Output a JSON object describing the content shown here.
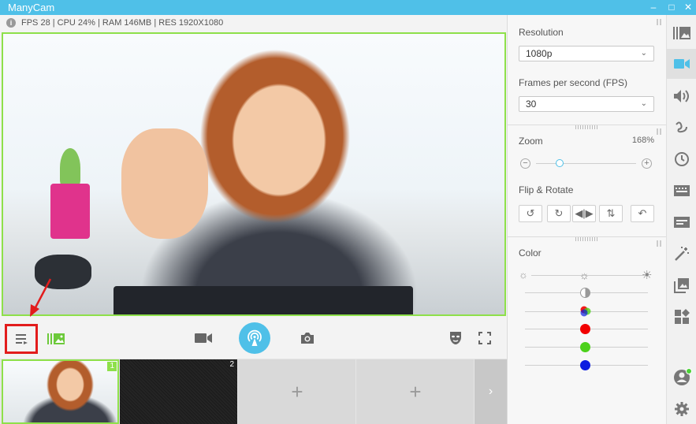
{
  "app": {
    "title": "ManyCam",
    "window_controls": {
      "minimize": "–",
      "maximize": "□",
      "close": "✕"
    }
  },
  "status_bar": {
    "info_icon": "i",
    "text": "FPS 28 | CPU 24% | RAM 146MB | RES 1920X1080"
  },
  "thumbnails": [
    {
      "number": "1",
      "type": "webcam",
      "active": true
    },
    {
      "number": "2",
      "type": "noise",
      "active": false
    },
    {
      "number": "",
      "type": "add",
      "add_label": "+"
    },
    {
      "number": "",
      "type": "add",
      "add_label": "+"
    }
  ],
  "thumbs_next": "›",
  "settings": {
    "resolution": {
      "label": "Resolution",
      "value": "1080p"
    },
    "fps": {
      "label": "Frames per second (FPS)",
      "value": "30"
    },
    "zoom": {
      "label": "Zoom",
      "value": "168%",
      "level_fraction": 0.1
    },
    "flip_rotate": {
      "label": "Flip & Rotate"
    },
    "color": {
      "label": "Color"
    }
  },
  "colors": {
    "accent": "#4fc0e8",
    "active_border": "#8ee04a",
    "highlight": "#e21c1c",
    "red": "#f20000",
    "green": "#4cd11a",
    "blue": "#0c1de0"
  },
  "sidebar_icons": [
    "presets-icon",
    "video-icon",
    "audio-icon",
    "draw-icon",
    "clock-icon",
    "lower-thirds-icon",
    "chat-icon",
    "effects-icon",
    "gallery-icon",
    "widgets-icon"
  ]
}
